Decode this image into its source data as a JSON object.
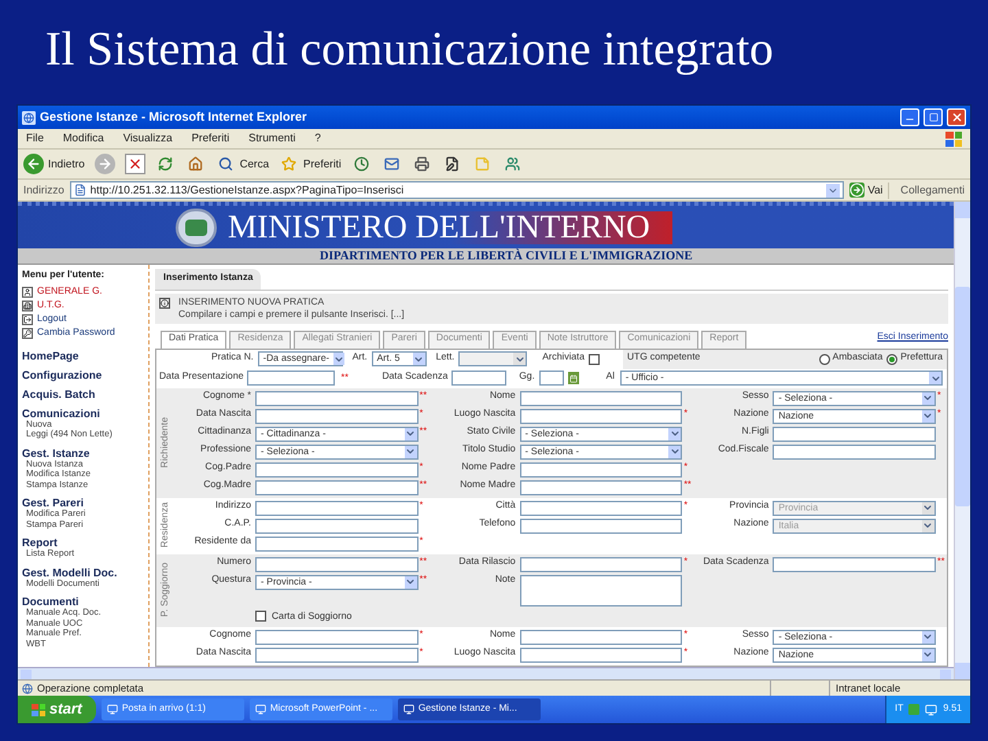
{
  "slide_title": "Il Sistema di comunicazione integrato",
  "window": {
    "title": "Gestione Istanze - Microsoft Internet Explorer"
  },
  "menu": [
    "File",
    "Modifica",
    "Visualizza",
    "Preferiti",
    "Strumenti",
    "?"
  ],
  "toolbar": [
    {
      "kind": "back",
      "label": "Indietro"
    },
    {
      "kind": "forward"
    },
    {
      "kind": "stop"
    },
    {
      "kind": "refresh"
    },
    {
      "kind": "home"
    },
    {
      "kind": "search",
      "label": "Cerca"
    },
    {
      "kind": "favorites",
      "label": "Preferiti"
    },
    {
      "kind": "history"
    },
    {
      "kind": "mail"
    },
    {
      "kind": "print"
    },
    {
      "kind": "edit"
    },
    {
      "kind": "note"
    },
    {
      "kind": "messenger"
    }
  ],
  "address": {
    "label": "Indirizzo",
    "url": "http://10.251.32.113/GestioneIstanze.aspx?PaginaTipo=Inserisci",
    "go": "Vai",
    "links": "Collegamenti"
  },
  "banner": {
    "title": "MINISTERO DELL'INTERNO",
    "subtitle": "DIPARTIMENTO PER LE LIBERTÀ CIVILI E L'IMMIGRAZIONE"
  },
  "sidebar": {
    "heading": "Menu per l'utente:",
    "user_items": [
      {
        "label": "GENERALE G.",
        "alert": true
      },
      {
        "label": "U.T.G.",
        "alert": true
      },
      {
        "label": "Logout",
        "alert": false
      },
      {
        "label": "Cambia Password",
        "alert": false
      }
    ],
    "sections": [
      {
        "label": "HomePage"
      },
      {
        "label": "Configurazione"
      },
      {
        "label": "Acquis. Batch"
      },
      {
        "label": "Comunicazioni",
        "children": [
          "Nuova",
          "Leggi (494 Non Lette)"
        ]
      },
      {
        "label": "Gest. Istanze",
        "children": [
          "Nuova Istanza",
          "Modifica Istanze",
          "Stampa Istanze"
        ]
      },
      {
        "label": "Gest. Pareri",
        "children": [
          "Modifica Pareri",
          "Stampa Pareri"
        ]
      },
      {
        "label": "Report",
        "children": [
          "Lista Report"
        ]
      },
      {
        "label": "Gest. Modelli Doc.",
        "children": [
          "Modelli Documenti"
        ]
      },
      {
        "label": "Documenti",
        "children": [
          "Manuale Acq. Doc.",
          "Manuale UOC",
          "Manuale Pref.",
          "WBT"
        ]
      }
    ]
  },
  "breadcrumb": "Inserimento Istanza",
  "notice": {
    "title": "INSERIMENTO NUOVA PRATICA",
    "text": "Compilare i campi e premere il pulsante Inserisci. [...]"
  },
  "tabs": [
    {
      "label": "Dati Pratica",
      "selected": true
    },
    {
      "label": "Residenza",
      "selected": false
    },
    {
      "label": "Allegati Stranieri",
      "selected": false
    },
    {
      "label": "Pareri",
      "selected": false
    },
    {
      "label": "Documenti",
      "selected": false
    },
    {
      "label": "Eventi",
      "selected": false
    },
    {
      "label": "Note Istruttore",
      "selected": false
    },
    {
      "label": "Comunicazioni",
      "selected": false
    },
    {
      "label": "Report",
      "selected": false
    }
  ],
  "exit_link": "Esci Inserimento",
  "header_form": {
    "pratica": {
      "label": "Pratica N.",
      "value": "-Da assegnare-"
    },
    "art": {
      "label": "Art.",
      "value": "Art. 5"
    },
    "lett": {
      "label": "Lett.",
      "disabled": true
    },
    "archiviata": {
      "label": "Archiviata",
      "checked": false
    },
    "data_presentazione": {
      "label": "Data Presentazione",
      "mark": "**"
    },
    "data_scadenza": {
      "label": "Data Scadenza"
    },
    "gg": {
      "label": "Gg."
    },
    "utg": {
      "label": "UTG competente",
      "options": [
        {
          "label": "Ambasciata",
          "selected": false
        },
        {
          "label": "Prefettura",
          "selected": true
        }
      ]
    },
    "ufficio": {
      "label": "Al",
      "value": "- Ufficio -"
    }
  },
  "sections": [
    {
      "title": "Richiedente",
      "rows": [
        [
          {
            "kind": "text",
            "label": "Cognome *",
            "mark": "**"
          },
          {
            "kind": "text",
            "label": "Nome"
          },
          {
            "kind": "select",
            "label": "Sesso",
            "value": "- Seleziona -",
            "mark": "*"
          }
        ],
        [
          {
            "kind": "text",
            "label": "Data Nascita",
            "mark": "*"
          },
          {
            "kind": "text",
            "label": "Luogo Nascita",
            "mark": "*"
          },
          {
            "kind": "select",
            "label": "Nazione",
            "value": "Nazione",
            "mark": "*"
          }
        ],
        [
          {
            "kind": "select",
            "label": "Cittadinanza",
            "value": "- Cittadinanza -",
            "mark": "**"
          },
          {
            "kind": "select",
            "label": "Stato Civile",
            "value": "- Seleziona -"
          },
          {
            "kind": "text",
            "label": "N.Figli"
          }
        ],
        [
          {
            "kind": "select",
            "label": "Professione",
            "value": "- Seleziona -"
          },
          {
            "kind": "select",
            "label": "Titolo Studio",
            "value": "- Seleziona -"
          },
          {
            "kind": "text",
            "label": "Cod.Fiscale"
          }
        ],
        [
          {
            "kind": "text",
            "label": "Cog.Padre",
            "mark": "*"
          },
          {
            "kind": "text",
            "label": "Nome Padre",
            "mark": "*"
          },
          null
        ],
        [
          {
            "kind": "text",
            "label": "Cog.Madre",
            "mark": "**"
          },
          {
            "kind": "text",
            "label": "Nome Madre",
            "mark": "**"
          },
          null
        ]
      ]
    },
    {
      "title": "Residenza",
      "rows": [
        [
          {
            "kind": "text",
            "label": "Indirizzo",
            "mark": "*"
          },
          {
            "kind": "text",
            "label": "Città",
            "mark": "*"
          },
          {
            "kind": "select",
            "label": "Provincia",
            "value": "Provincia",
            "disabled": true
          }
        ],
        [
          {
            "kind": "text",
            "label": "C.A.P."
          },
          {
            "kind": "text",
            "label": "Telefono"
          },
          {
            "kind": "select",
            "label": "Nazione",
            "value": "Italia",
            "disabled": true
          }
        ],
        [
          {
            "kind": "text",
            "label": "Residente da",
            "mark": "*"
          },
          null,
          null
        ]
      ]
    },
    {
      "title": "P. Soggiorno",
      "rows": [
        [
          {
            "kind": "text",
            "label": "Numero",
            "mark": "**"
          },
          {
            "kind": "text",
            "label": "Data Rilascio",
            "mark": "*"
          },
          {
            "kind": "text",
            "label": "Data Scadenza",
            "mark": "**"
          }
        ],
        [
          {
            "kind": "select",
            "label": "Questura",
            "value": "- Provincia -",
            "mark": "**"
          },
          {
            "kind": "textarea",
            "label": "Note"
          },
          null
        ],
        [
          {
            "kind": "checkbox",
            "label": "Carta di Soggiorno",
            "checked": false
          },
          null,
          null
        ]
      ]
    },
    {
      "rows": [
        [
          {
            "kind": "text",
            "label": "Cognome",
            "mark": "*"
          },
          {
            "kind": "text",
            "label": "Nome",
            "mark": "*"
          },
          {
            "kind": "select",
            "label": "Sesso",
            "value": "- Seleziona -"
          }
        ],
        [
          {
            "kind": "text",
            "label": "Data Nascita",
            "mark": "*"
          },
          {
            "kind": "text",
            "label": "Luogo Nascita",
            "mark": "*"
          },
          {
            "kind": "select",
            "label": "Nazione",
            "value": "Nazione"
          }
        ]
      ]
    }
  ],
  "status_bar": {
    "text": "Operazione completata",
    "zone": "Intranet locale"
  },
  "taskbar": {
    "start": "start",
    "tasks": [
      {
        "label": "Posta in arrivo (1:1)",
        "selected": false
      },
      {
        "label": "Microsoft PowerPoint - ...",
        "selected": false
      },
      {
        "label": "Gestione Istanze - Mi...",
        "selected": true
      }
    ],
    "lang": "IT",
    "clock": "9.51"
  }
}
